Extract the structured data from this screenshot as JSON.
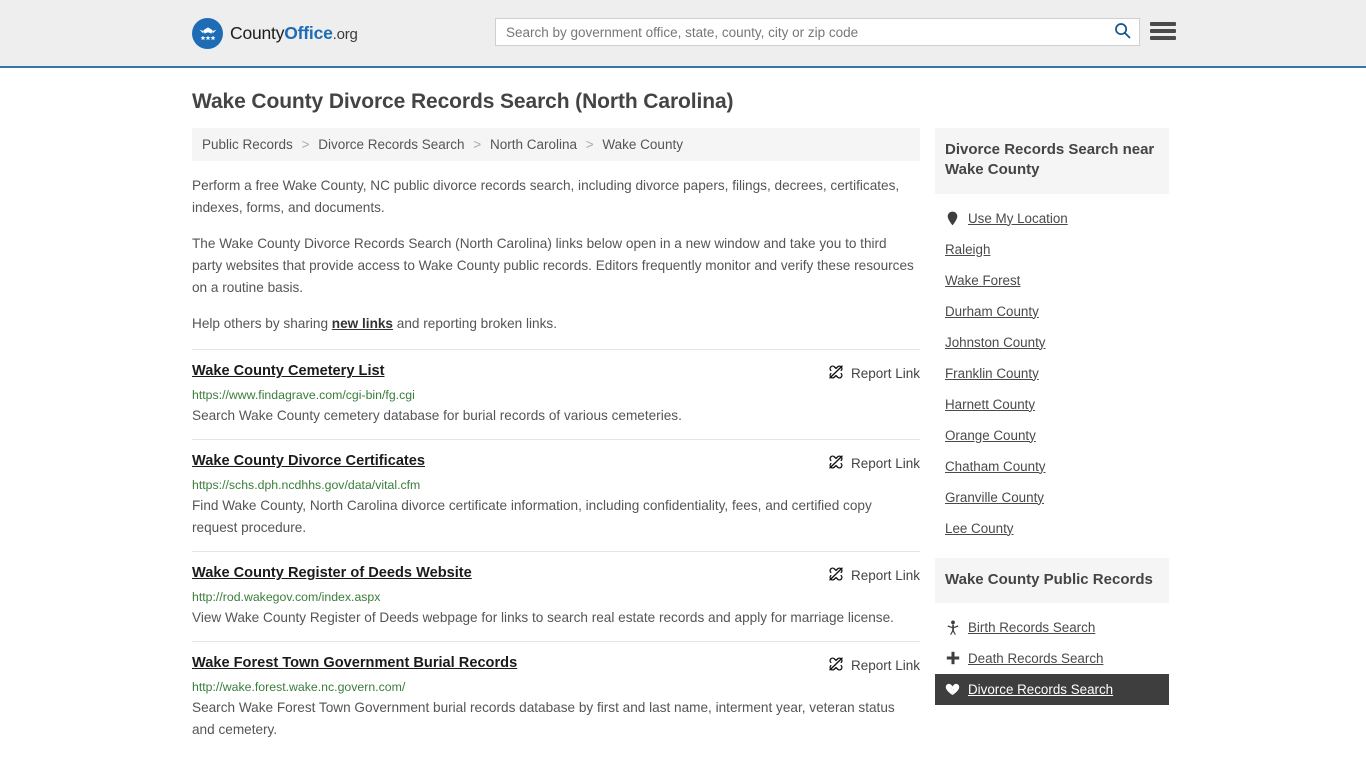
{
  "header": {
    "brand": {
      "part1": "County",
      "part2": "Office",
      "part3": ".org",
      "logo_icon": "eagle-stars-icon"
    },
    "search": {
      "placeholder": "Search by government office, state, county, city or zip code",
      "value": "",
      "search_icon": "search-icon"
    },
    "menu_icon": "hamburger-menu-icon",
    "accent_color": "#1d6cb5",
    "background_color": "#eeeeee",
    "border_color": "#3b72a8"
  },
  "page_title": "Wake County Divorce Records Search (North Carolina)",
  "breadcrumb": {
    "items": [
      {
        "label": "Public Records"
      },
      {
        "label": "Divorce Records Search"
      },
      {
        "label": "North Carolina"
      },
      {
        "label": "Wake County"
      }
    ],
    "separator": ">"
  },
  "intro": {
    "p1": "Perform a free Wake County, NC public divorce records search, including divorce papers, filings, decrees, certificates, indexes, forms, and documents.",
    "p2": "The Wake County Divorce Records Search (North Carolina) links below open in a new window and take you to third party websites that provide access to Wake County public records. Editors frequently monitor and verify these resources on a routine basis.",
    "p3_before": "Help others by sharing ",
    "p3_link": "new links",
    "p3_after": " and reporting broken links."
  },
  "results": {
    "report_label": "Report Link",
    "report_icon": "broken-link-icon",
    "items": [
      {
        "title": "Wake County Cemetery List",
        "url": "https://www.findagrave.com/cgi-bin/fg.cgi",
        "description": "Search Wake County cemetery database for burial records of various cemeteries."
      },
      {
        "title": "Wake County Divorce Certificates",
        "url": "https://schs.dph.ncdhhs.gov/data/vital.cfm",
        "description": "Find Wake County, North Carolina divorce certificate information, including confidentiality, fees, and certified copy request procedure."
      },
      {
        "title": "Wake County Register of Deeds Website",
        "url": "http://rod.wakegov.com/index.aspx",
        "description": "View Wake County Register of Deeds webpage for links to search real estate records and apply for marriage license."
      },
      {
        "title": "Wake Forest Town Government Burial Records",
        "url": "http://wake.forest.wake.nc.govern.com/",
        "description": "Search Wake Forest Town Government burial records database by first and last name, interment year, veteran status and cemetery."
      }
    ]
  },
  "sidebar": {
    "nearby_panel": {
      "title": "Divorce Records Search near Wake County",
      "items": [
        {
          "label": "Use My Location",
          "icon": "map-pin-icon"
        },
        {
          "label": "Raleigh",
          "icon": ""
        },
        {
          "label": "Wake Forest",
          "icon": ""
        },
        {
          "label": "Durham County",
          "icon": ""
        },
        {
          "label": "Johnston County",
          "icon": ""
        },
        {
          "label": "Franklin County",
          "icon": ""
        },
        {
          "label": "Harnett County",
          "icon": ""
        },
        {
          "label": "Orange County",
          "icon": ""
        },
        {
          "label": "Chatham County",
          "icon": ""
        },
        {
          "label": "Granville County",
          "icon": ""
        },
        {
          "label": "Lee County",
          "icon": ""
        }
      ]
    },
    "records_panel": {
      "title": "Wake County Public Records",
      "items": [
        {
          "label": "Birth Records Search",
          "icon": "baby-icon",
          "active": false
        },
        {
          "label": "Death Records Search",
          "icon": "cross-icon",
          "active": false
        },
        {
          "label": "Divorce Records Search",
          "icon": "broken-heart-icon",
          "active": true
        }
      ]
    }
  }
}
